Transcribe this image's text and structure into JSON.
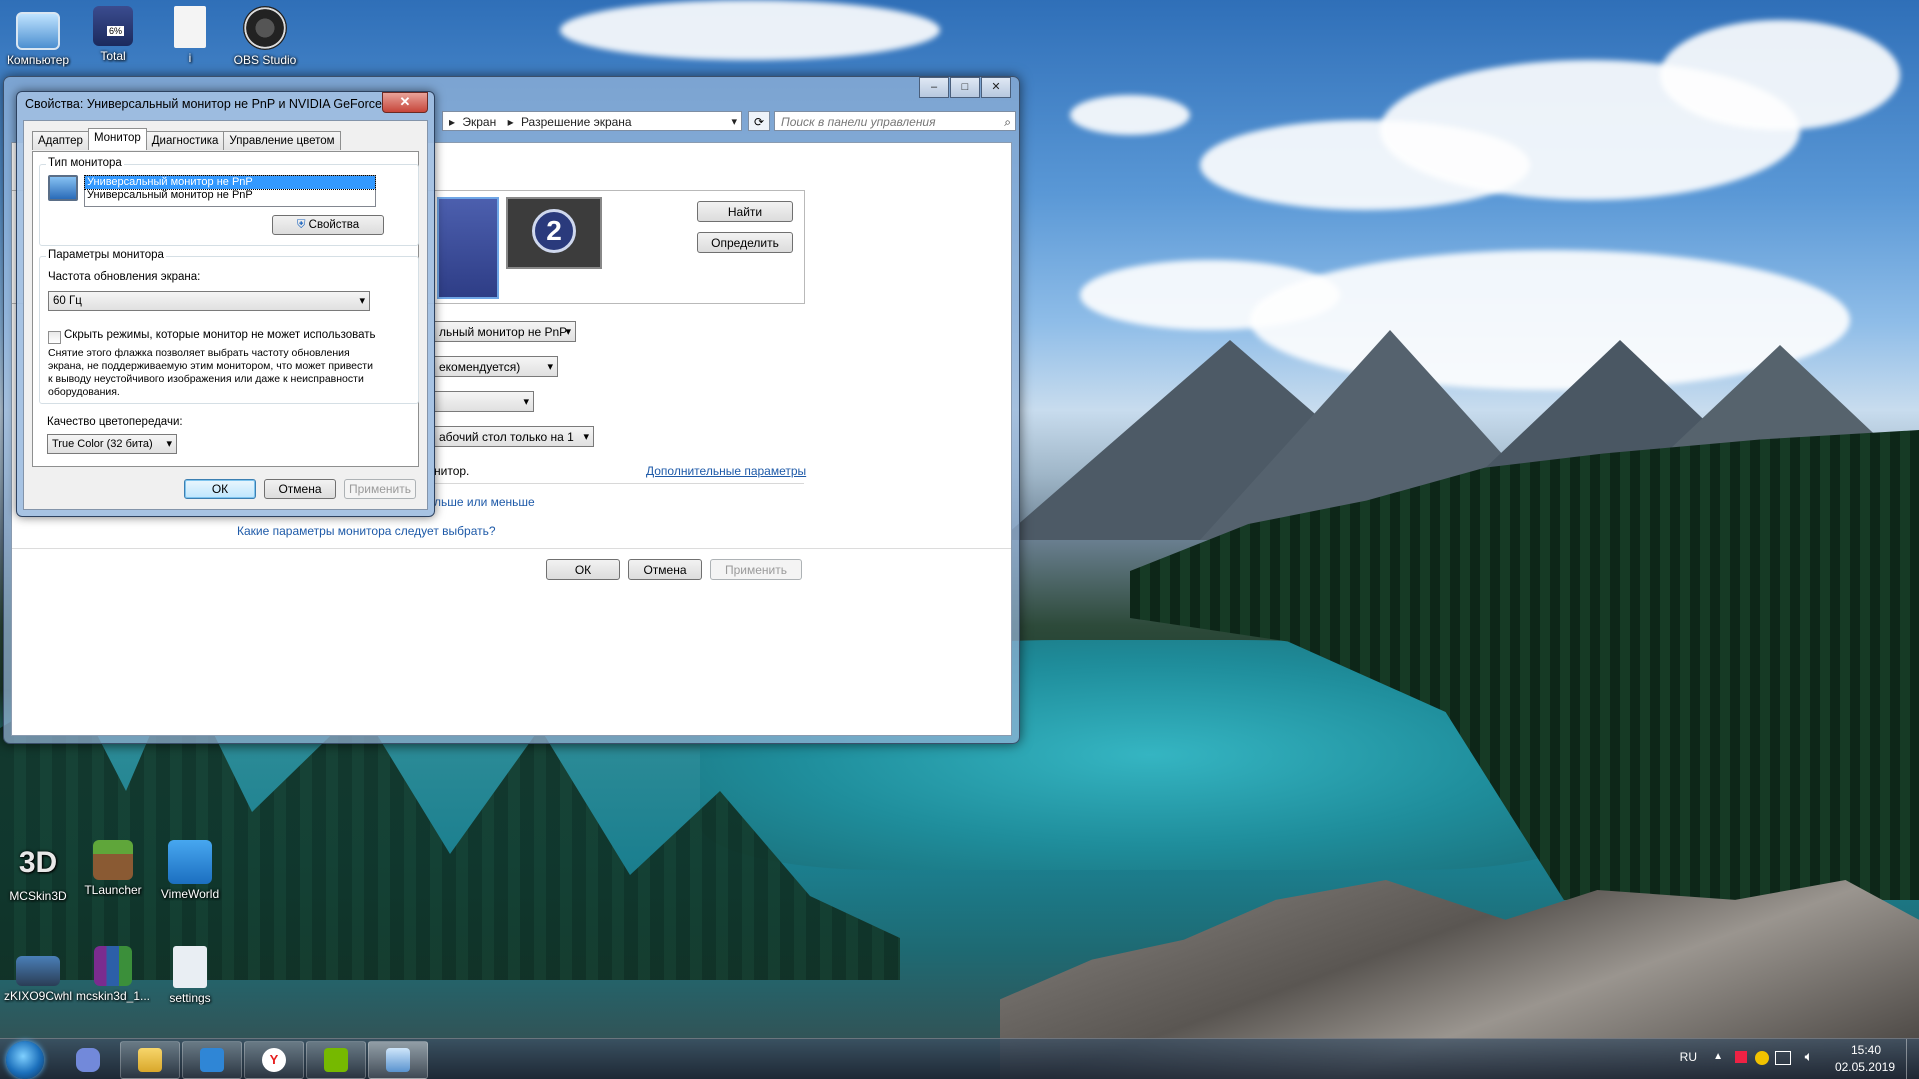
{
  "desktop": {
    "icons_top": [
      {
        "label": "Компьютер",
        "icon": "computer-icon"
      },
      {
        "label": "Total",
        "icon": "floppy-icon",
        "badge": "6%"
      },
      {
        "label": "i",
        "icon": "document-icon"
      },
      {
        "label": "OBS Studio",
        "icon": "obs-icon"
      }
    ],
    "icons_bottom_row1": [
      {
        "label": "MCSkin3D",
        "icon": "mcskin3d-icon",
        "glyph": "3D"
      },
      {
        "label": "TLauncher",
        "icon": "tlauncher-icon"
      },
      {
        "label": "VimeWorld",
        "icon": "vimeworld-icon"
      }
    ],
    "icons_bottom_row2": [
      {
        "label": "zKIXO9Cwhl",
        "icon": "image-file-icon"
      },
      {
        "label": "mcskin3d_1...",
        "icon": "winrar-icon"
      },
      {
        "label": "settings",
        "icon": "settings-icon"
      }
    ]
  },
  "back_window": {
    "breadcrumb_sep": "▸",
    "breadcrumb": [
      "Экран",
      "Разрешение экрана"
    ],
    "search_placeholder": "Поиск в панели управления",
    "monitor2_label": "2",
    "find_button": "Найти",
    "detect_button": "Определить",
    "display_combo": "льный монитор не PnP",
    "resolution_combo": "екомендуется)",
    "orientation_combo": "",
    "multi_display_combo": "абочий стол только на 1",
    "main_display_text": "нитор.",
    "advanced_link": "Дополнительные параметры",
    "size_link": "льше или меньше",
    "which_settings_link": "Какие параметры монитора следует выбрать?",
    "ok": "ОК",
    "cancel": "Отмена",
    "apply": "Применить"
  },
  "dialog": {
    "title": "Свойства: Универсальный монитор не PnP и NVIDIA GeForce G...",
    "close": "✕",
    "tabs": [
      "Адаптер",
      "Монитор",
      "Диагностика",
      "Управление цветом"
    ],
    "active_tab": "Монитор",
    "monitor_type_group": "Тип монитора",
    "monitor_list": [
      "Универсальный монитор не PnP",
      "Универсальный монитор не PnP"
    ],
    "properties_button": "Свойства",
    "monitor_settings_group": "Параметры монитора",
    "refresh_label": "Частота обновления экрана:",
    "refresh_value": "60 Гц",
    "hide_modes_label": "Скрыть режимы, которые монитор не может использовать",
    "hide_modes_checked": false,
    "hide_modes_note": "Снятие этого флажка позволяет выбрать частоту обновления экрана, не поддерживаемую этим монитором, что может привести к выводу неустойчивого изображения или даже к неисправности оборудования.",
    "color_quality_label": "Качество цветопередачи:",
    "color_quality_value": "True Color (32 бита)",
    "ok": "ОК",
    "cancel": "Отмена",
    "apply": "Применить"
  },
  "taskbar": {
    "pinned": [
      "discord-icon",
      "explorer-icon",
      "vimeworld-icon",
      "yandex-browser-icon",
      "nvidia-icon",
      "control-panel-icon"
    ],
    "language": "RU",
    "time": "15:40",
    "date": "02.05.2019"
  }
}
